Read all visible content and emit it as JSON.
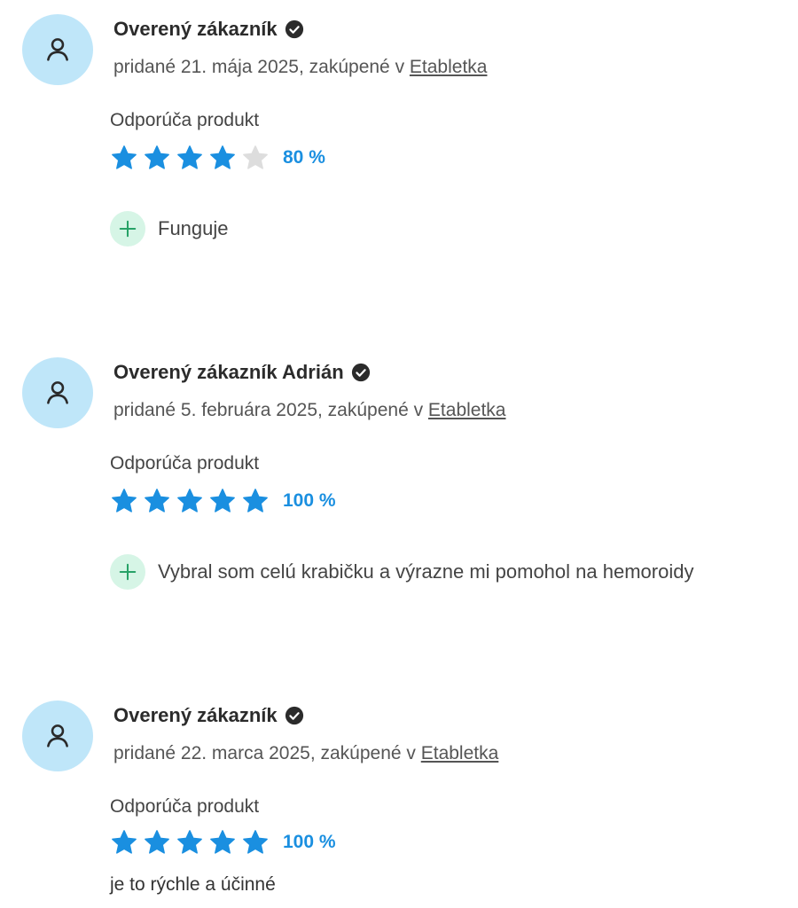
{
  "reviews": [
    {
      "name": "Overený zákazník",
      "meta_prefix": "pridané 21. mája 2025, zakúpené v ",
      "shop": "Etabletka",
      "recommend_label": "Odporúča produkt",
      "stars": 4,
      "percent": "80 %",
      "pro": "Funguje"
    },
    {
      "name": "Overený zákazník Adrián",
      "meta_prefix": "pridané 5. februára 2025, zakúpené v ",
      "shop": "Etabletka",
      "recommend_label": "Odporúča produkt",
      "stars": 5,
      "percent": "100 %",
      "pro": "Vybral som celú krabičku a výrazne mi pomohol na hemoroidy"
    },
    {
      "name": "Overený zákazník",
      "meta_prefix": "pridané 22. marca 2025, zakúpené v ",
      "shop": "Etabletka",
      "recommend_label": "Odporúča produkt",
      "stars": 5,
      "percent": "100 %",
      "text": "je to rýchle a účinné"
    }
  ],
  "colors": {
    "star_filled": "#1a8fe0",
    "star_empty": "#dddddd",
    "avatar_bg": "#bfe6f9",
    "plus_bg": "#d6f5e6",
    "plus_icon": "#27a267"
  },
  "icons": {
    "avatar": "user-icon",
    "verified": "check-circle-icon",
    "star": "star-icon",
    "pro": "plus-icon"
  }
}
